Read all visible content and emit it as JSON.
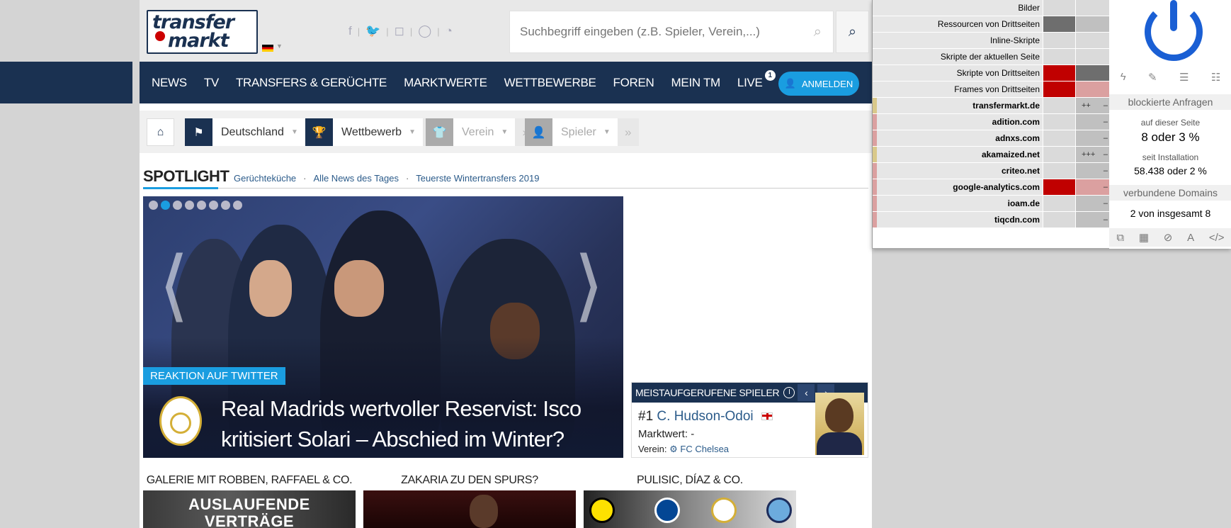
{
  "header": {
    "logo_line1": "transfer",
    "logo_line2": "markt",
    "social_icons": [
      "facebook-icon",
      "twitter-icon",
      "instagram-icon",
      "whatsapp-icon",
      "rss-icon"
    ],
    "search_placeholder": "Suchbegriff eingeben (z.B. Spieler, Verein,...)"
  },
  "nav": {
    "items": [
      "NEWS",
      "TV",
      "TRANSFERS & GERÜCHTE",
      "MARKTWERTE",
      "WETTBEWERBE",
      "FOREN",
      "MEIN TM",
      "LIVE"
    ],
    "live_badge": "1",
    "login_label": "ANMELDEN"
  },
  "subnav": {
    "country": "Deutschland",
    "competition": "Wettbewerb",
    "club": "Verein",
    "player": "Spieler"
  },
  "spotlight": {
    "title": "SPOTLIGHT",
    "links": [
      "Gerüchteküche",
      "Alle News des Tages",
      "Teuerste Wintertransfers 2019"
    ]
  },
  "hero": {
    "tag": "REAKTION AUF TWITTER",
    "headline_line1": "Real Madrids wertvoller Reservist: Isco",
    "headline_line2": "kritisiert Solari – Abschied im Winter?",
    "prev_arrow": "⟨",
    "next_arrow": "⟩",
    "slides": 8,
    "active_slide": 2
  },
  "widget": {
    "title": "MEISTAUFGERUFENE SPIELER",
    "rank": "#1",
    "player": "C. Hudson-Odoi",
    "market_value_label": "Marktwert:",
    "market_value": "-",
    "club_label": "Verein:",
    "club": "FC Chelsea"
  },
  "gallery": {
    "items": [
      "GALERIE MIT ROBBEN, RAFFAEL & CO.",
      "ZAKARIA ZU DEN SPURS?",
      "PULISIC, DÍAZ & CO."
    ],
    "overlay_text": "AUSLAUFENDE VERTRÄGE"
  },
  "umatrix": {
    "rows": [
      {
        "name": "Bilder",
        "c1": "",
        "c2": "",
        "type": "category"
      },
      {
        "name": "Ressourcen von Drittseiten",
        "c1": "",
        "c2": "",
        "type": "category"
      },
      {
        "name": "Inline-Skripte",
        "c1": "",
        "c2": "",
        "type": "category"
      },
      {
        "name": "Skripte der aktuellen Seite",
        "c1": "",
        "c2": "",
        "type": "category"
      },
      {
        "name": "Skripte von Drittseiten",
        "c1": "",
        "c2": "",
        "type": "category"
      },
      {
        "name": "Frames von Drittseiten",
        "c1": "",
        "c2": "",
        "type": "category"
      },
      {
        "name": "transfermarkt.de",
        "c1": "",
        "c2": "++",
        "type": "domain"
      },
      {
        "name": "adition.com",
        "c1": "",
        "c2": "",
        "type": "domain"
      },
      {
        "name": "adnxs.com",
        "c1": "",
        "c2": "",
        "type": "domain"
      },
      {
        "name": "akamaized.net",
        "c1": "",
        "c2": "+++",
        "type": "domain"
      },
      {
        "name": "criteo.net",
        "c1": "",
        "c2": "",
        "type": "domain"
      },
      {
        "name": "google-analytics.com",
        "c1": "",
        "c2": "",
        "type": "domain"
      },
      {
        "name": "ioam.de",
        "c1": "",
        "c2": "",
        "type": "domain"
      },
      {
        "name": "tiqcdn.com",
        "c1": "",
        "c2": "",
        "type": "domain"
      }
    ],
    "blocked_label": "blockierte Anfragen",
    "on_page_label": "auf dieser Seite",
    "on_page_value": "8 oder 3 %",
    "since_install_label": "seit Installation",
    "since_install_value": "58.438 oder 2 %",
    "domains_label": "verbundene Domains",
    "domains_value": "2 von insgesamt 8",
    "colors": {
      "blocked": "#c00000",
      "blocked_light": "#dba0a0",
      "allowed_dark": "#6e6e6e",
      "neutral": "#c0c0c0",
      "power": "#1a5fd4"
    }
  }
}
